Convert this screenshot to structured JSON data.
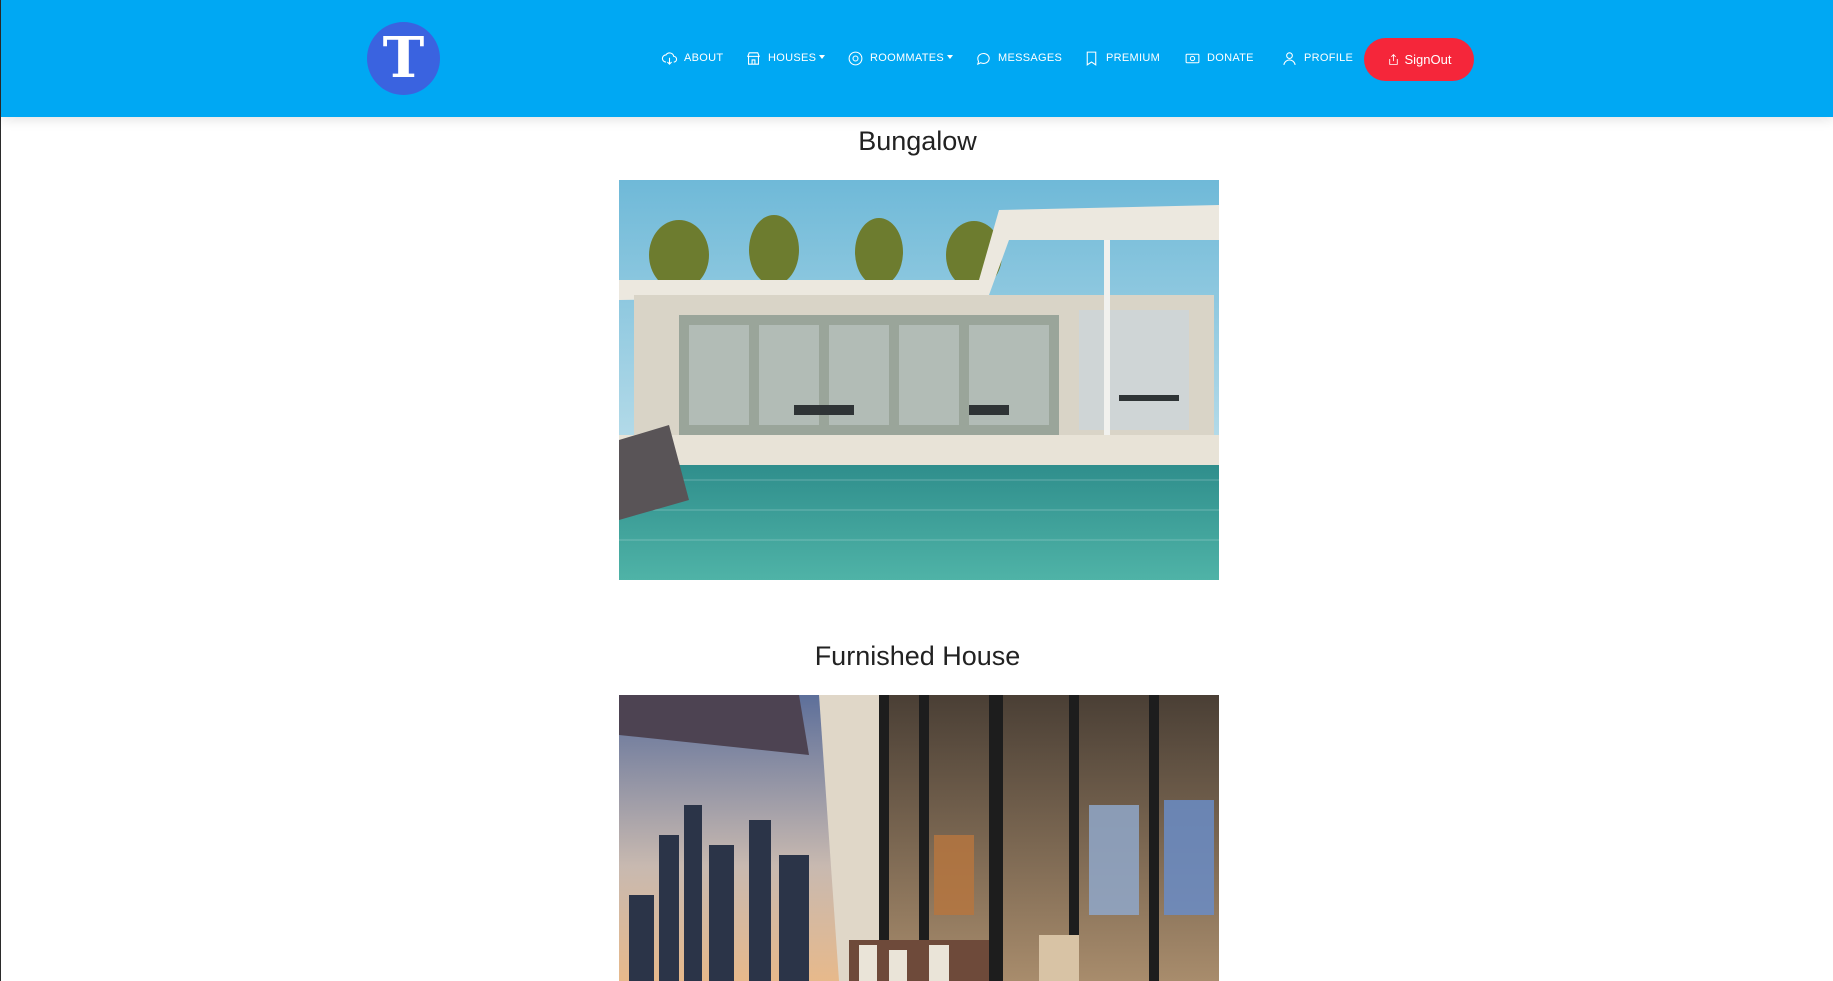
{
  "brand": {
    "logo_letter": "T",
    "color": "#3a63e0"
  },
  "nav": {
    "background": "#00a8f3",
    "items": [
      {
        "label": "ABOUT",
        "icon": "cloud-download-icon"
      },
      {
        "label": "HOUSES",
        "icon": "storefront-icon",
        "dropdown": true
      },
      {
        "label": "ROOMMATES",
        "icon": "at-sign-icon",
        "dropdown": true
      },
      {
        "label": "MESSAGES",
        "icon": "chat-bubble-icon"
      },
      {
        "label": "PREMIUM",
        "icon": "bookmark-icon"
      },
      {
        "label": "DONATE",
        "icon": "money-icon"
      },
      {
        "label": "PROFILE",
        "icon": "user-icon"
      }
    ],
    "signout": {
      "label": "SignOut",
      "icon": "export-icon",
      "color": "#f5263a"
    }
  },
  "listings": [
    {
      "title": "Bungalow",
      "image": "bungalow-pool-photo"
    },
    {
      "title": "Furnished House",
      "image": "furnished-house-city-view-photo"
    }
  ]
}
